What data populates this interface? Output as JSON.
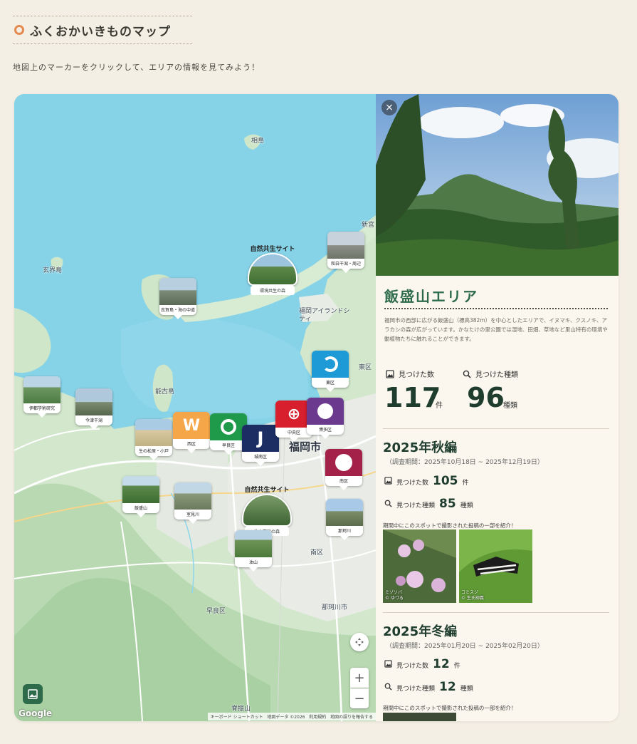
{
  "header": {
    "title": "ふくおかいきものマップ",
    "subtitle": "地図上のマーカーをクリックして、エリアの情報を見てみよう！"
  },
  "map": {
    "place_labels": [
      "相島",
      "玄界島",
      "能古島",
      "新宮",
      "福岡アイランドシティ",
      "東区",
      "福岡市",
      "南区",
      "早良区",
      "那珂川市",
      "脊振山"
    ],
    "markers": [
      {
        "label": "志賀島・海の中道",
        "kind": "photo"
      },
      {
        "label": "和白干潟・周辺",
        "kind": "photo"
      },
      {
        "label": "環境共生の森",
        "kind": "nature",
        "banner": "自然共生サイト"
      },
      {
        "label": "東区",
        "kind": "ward"
      },
      {
        "label": "伊都学術研究",
        "kind": "photo"
      },
      {
        "label": "今津干潟",
        "kind": "photo"
      },
      {
        "label": "生の松原・小戸",
        "kind": "photo"
      },
      {
        "label": "西区",
        "kind": "ward"
      },
      {
        "label": "早良区",
        "kind": "ward"
      },
      {
        "label": "城南区",
        "kind": "ward"
      },
      {
        "label": "中央区",
        "kind": "ward"
      },
      {
        "label": "博多区",
        "kind": "ward"
      },
      {
        "label": "南区",
        "kind": "ward"
      },
      {
        "label": "飯盛山",
        "kind": "photo"
      },
      {
        "label": "室見川",
        "kind": "photo"
      },
      {
        "label": "油山市民の森",
        "kind": "nature",
        "banner": "自然共生サイト"
      },
      {
        "label": "那珂川",
        "kind": "photo"
      },
      {
        "label": "油山",
        "kind": "photo"
      }
    ],
    "google_logo": "Google",
    "attribution": [
      "キーボード ショートカット",
      "地図データ ©2026",
      "利用規約",
      "地図の誤りを報告する"
    ],
    "zoom_in": "+",
    "zoom_out": "−"
  },
  "panel": {
    "close": "×",
    "area_title": "飯盛山エリア",
    "description": "福岡市の西部に広がる飯盛山（標高382m）を中心としたエリアで、イヌマキ、クスノキ、アラカシの森が広がっています。かなたけの里公園では湿地、田畑、草地など里山特有の環境や動植物たちに触れることができます。",
    "found_count_label": "見つけた数",
    "found_species_label": "見つけた種類",
    "total_count": "117",
    "total_count_unit": "件",
    "total_species": "96",
    "total_species_unit": "種類",
    "seasons": [
      {
        "title": "2025年秋編",
        "period": "（調査期間：2025年10月18日 ~ 2025年12月19日）",
        "count_label": "見つけた数",
        "count": "105",
        "count_unit": "件",
        "species_label": "見つけた種類",
        "species": "85",
        "species_unit": "種類",
        "note": "期間中にこのスポットで撮影された投稿の一部を紹介！",
        "photos": [
          {
            "name": "ミゾソバ",
            "credit": "© ゆづる"
          },
          {
            "name": "コミスジ",
            "credit": "© 生氏柳義"
          }
        ]
      },
      {
        "title": "2025年冬編",
        "period": "（調査期間：2025年01月20日 ~ 2025年02月20日）",
        "count_label": "見つけた数",
        "count": "12",
        "count_unit": "件",
        "species_label": "見つけた種類",
        "species": "12",
        "species_unit": "種類",
        "note": "期間中にこのスポットで撮影された投稿の一部を紹介！"
      }
    ]
  },
  "colors": {
    "accent_green": "#2d6b4a",
    "title_dot": "#e58a4e",
    "page_bg": "#f4efe4",
    "sea": "#86d3e8"
  }
}
